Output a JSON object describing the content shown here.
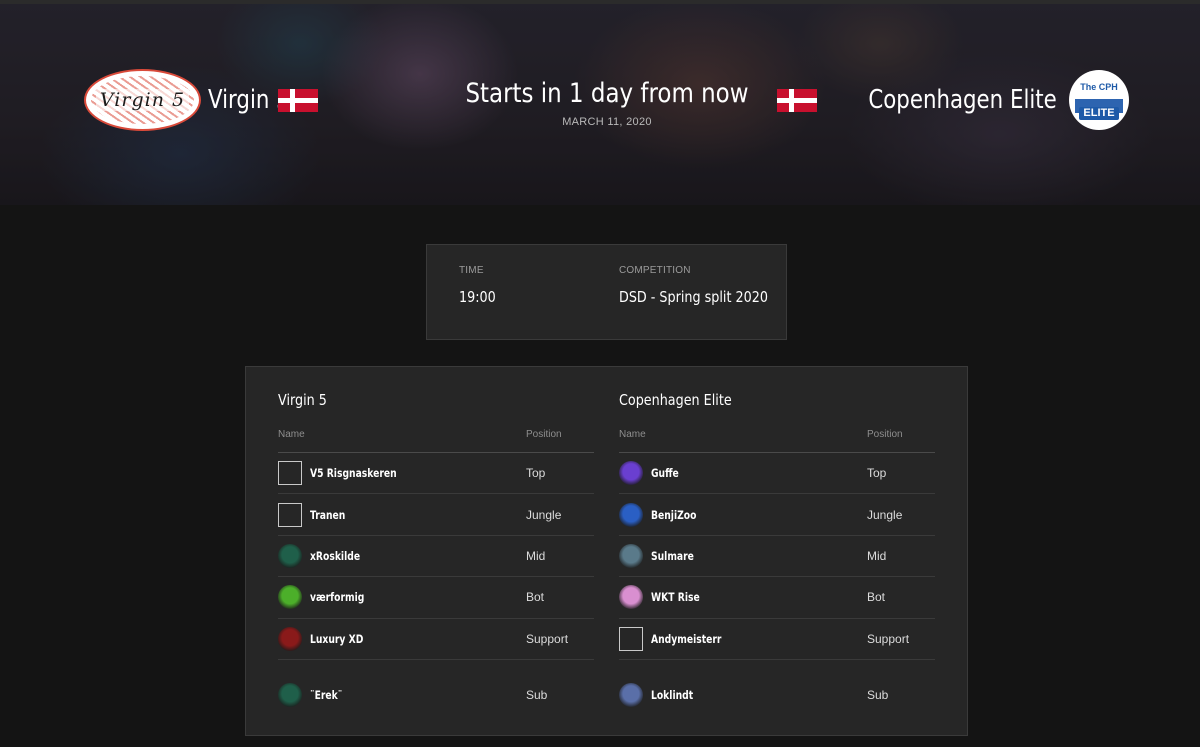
{
  "match": {
    "status": "Starts in 1 day from now",
    "date": "MARCH 11, 2020"
  },
  "home_team": {
    "name": "Virgin 5",
    "logo_text": "Virgin 5",
    "flag": "denmark-flag"
  },
  "away_team": {
    "name": "Copenhagen Elite",
    "logo_text_top": "The CPH",
    "logo_text_bottom": "ELITE",
    "flag": "denmark-flag"
  },
  "details": {
    "time_label": "TIME",
    "time_value": "19:00",
    "competition_label": "COMPETITION",
    "competition_value": "DSD - Spring split 2020"
  },
  "rosters": {
    "name_header": "Name",
    "position_header": "Position",
    "home": {
      "title": "Virgin 5",
      "players": [
        {
          "name": "V5 Risgnaskeren",
          "position": "Top",
          "avatar": "broken-image",
          "color": "#262626"
        },
        {
          "name": "Tranen",
          "position": "Jungle",
          "avatar": "broken-image",
          "color": "#262626"
        },
        {
          "name": "xRoskilde",
          "position": "Mid",
          "avatar": "rose-icon",
          "color": "#1f5f4a"
        },
        {
          "name": "værformig",
          "position": "Bot",
          "avatar": "green-champion-icon",
          "color": "#4caf2a"
        },
        {
          "name": "Luxury XD",
          "position": "Support",
          "avatar": "red-champion-icon",
          "color": "#8a1a1a"
        }
      ],
      "sub": {
        "name": "¨Erek¨",
        "position": "Sub",
        "avatar": "rose-icon",
        "color": "#1f5f4a"
      }
    },
    "away": {
      "title": "Copenhagen Elite",
      "players": [
        {
          "name": "Guffe",
          "position": "Top",
          "avatar": "purple-flame-icon",
          "color": "#6a3fd0"
        },
        {
          "name": "BenjiZoo",
          "position": "Jungle",
          "avatar": "blue-dragon-icon",
          "color": "#2a5fc4"
        },
        {
          "name": "Sulmare",
          "position": "Mid",
          "avatar": "masked-face-icon",
          "color": "#5a7a8a"
        },
        {
          "name": "WKT Rise",
          "position": "Bot",
          "avatar": "pink-penguin-icon",
          "color": "#d98fd0"
        },
        {
          "name": "Andymeisterr",
          "position": "Support",
          "avatar": "broken-image",
          "color": "#262626"
        }
      ],
      "sub": {
        "name": "Loklindt",
        "position": "Sub",
        "avatar": "armored-champion-icon",
        "color": "#5a6fa8"
      }
    }
  }
}
